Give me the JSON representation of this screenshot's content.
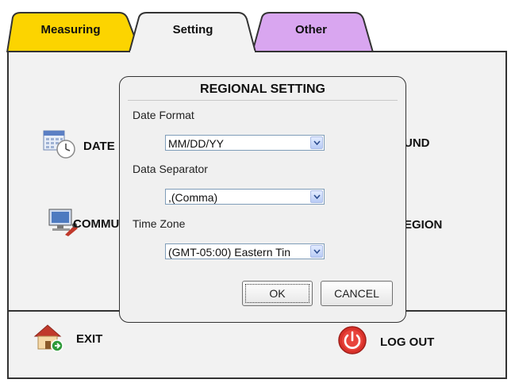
{
  "tabs": [
    {
      "label": "Measuring",
      "color": "#fcd400"
    },
    {
      "label": "Setting",
      "color": "#f2f2f2",
      "active": true
    },
    {
      "label": "Other",
      "color": "#d9a6f0"
    }
  ],
  "menu": {
    "date": {
      "label": "DATE",
      "icon": "calendar-clock-icon"
    },
    "comm": {
      "label": "COMMU",
      "icon": "computer-network-icon"
    },
    "sound": {
      "label": "UND"
    },
    "region": {
      "label": "EGION"
    },
    "exit": {
      "label": "EXIT",
      "icon": "home-exit-icon"
    },
    "logout": {
      "label": "LOG OUT",
      "icon": "power-icon"
    }
  },
  "dialog": {
    "title": "REGIONAL SETTING",
    "date_format": {
      "label": "Date Format",
      "value": "MM/DD/YY"
    },
    "data_separator": {
      "label": "Data Separator",
      "value": ",(Comma)"
    },
    "time_zone": {
      "label": "Time Zone",
      "value": "(GMT-05:00) Eastern Tin"
    },
    "ok_label": "OK",
    "cancel_label": "CANCEL"
  }
}
